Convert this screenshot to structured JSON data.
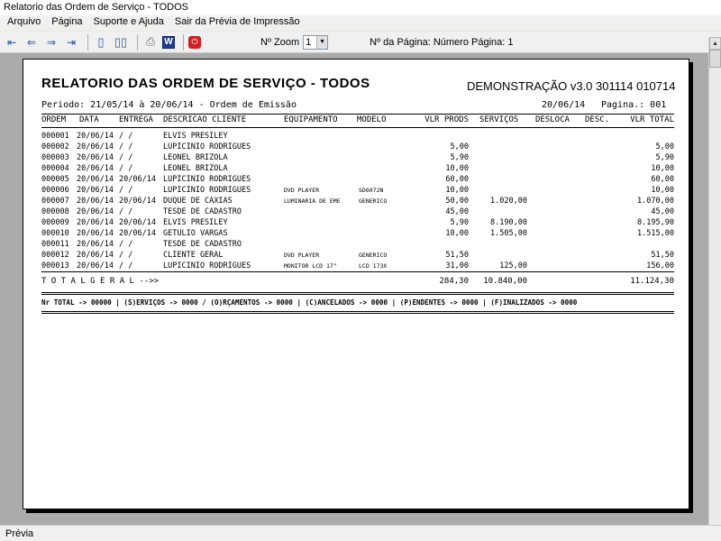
{
  "window": {
    "title": "Relatorio das Ordem de Serviço - TODOS"
  },
  "menu": [
    "Arquivo",
    "Página",
    "Suporte e Ajuda",
    "Sair da Prévia de Impressão"
  ],
  "toolbar": {
    "icons": [
      "first-page-icon",
      "prev-page-icon",
      "next-page-icon",
      "last-page-icon",
      "single-page-icon",
      "two-pages-icon",
      "printer-icon",
      "word-export-icon",
      "stop-icon"
    ],
    "zoom_label": "Nº Zoom",
    "zoom_value": "1",
    "page_info": "Nº da Página: Número Página: 1"
  },
  "report": {
    "title": "RELATORIO DAS ORDEM DE SERVIÇO - TODOS",
    "version": "DEMONSTRAÇÃO v3.0 301114 010714",
    "periodo": "Periodo: 21/05/14 à 20/06/14 - Ordem de Emissão",
    "date": "20/06/14",
    "pagina": "Pagina.: 001",
    "columns": {
      "ordem": "ORDEM",
      "data": "DATA",
      "entrega": "ENTREGA",
      "cliente": "DESCRICAO CLIENTE",
      "equipamento": "EQUIPAMENTO",
      "modelo": "MODELO",
      "vlr_prods": "VLR PRODS",
      "servicos": "SERVIÇOS",
      "desloca": "DESLOCA",
      "desc": "DESC.",
      "vlr_total": "VLR TOTAL"
    },
    "rows": [
      {
        "ordem": "000001",
        "data": "20/06/14",
        "entrega": " /  /",
        "cliente": "ELVIS PRESILEY",
        "equip": "",
        "modelo": "",
        "vlr": "",
        "serv": "",
        "total": ""
      },
      {
        "ordem": "000002",
        "data": "20/06/14",
        "entrega": " /  /",
        "cliente": "LUPICINIO RODRIGUES",
        "equip": "",
        "modelo": "",
        "vlr": "5,00",
        "serv": "",
        "total": "5,00"
      },
      {
        "ordem": "000003",
        "data": "20/06/14",
        "entrega": " /  /",
        "cliente": "LEONEL BRIZOLA",
        "equip": "",
        "modelo": "",
        "vlr": "5,90",
        "serv": "",
        "total": "5,90"
      },
      {
        "ordem": "000004",
        "data": "20/06/14",
        "entrega": " /  /",
        "cliente": "LEONEL BRIZOLA",
        "equip": "",
        "modelo": "",
        "vlr": "10,00",
        "serv": "",
        "total": "10,00"
      },
      {
        "ordem": "000005",
        "data": "20/06/14",
        "entrega": "20/06/14",
        "cliente": "LUPICINIO RODRIGUES",
        "equip": "",
        "modelo": "",
        "vlr": "60,00",
        "serv": "",
        "total": "60,00"
      },
      {
        "ordem": "000006",
        "data": "20/06/14",
        "entrega": " /  /",
        "cliente": "LUPICINIO RODRIGUES",
        "equip": "DVD PLAYER",
        "modelo": "SD6072N",
        "vlr": "10,00",
        "serv": "",
        "total": "10,00"
      },
      {
        "ordem": "000007",
        "data": "20/06/14",
        "entrega": "20/06/14",
        "cliente": "DUQUE DE CAXIAS",
        "equip": "LUMINARIA DE EME",
        "modelo": "GENERICO",
        "vlr": "50,00",
        "serv": "1.020,00",
        "total": "1.070,00"
      },
      {
        "ordem": "000008",
        "data": "20/06/14",
        "entrega": " /  /",
        "cliente": "TESDE DE CADASTRO",
        "equip": "",
        "modelo": "",
        "vlr": "45,00",
        "serv": "",
        "total": "45,00"
      },
      {
        "ordem": "000009",
        "data": "20/06/14",
        "entrega": "20/06/14",
        "cliente": "ELVIS PRESILEY",
        "equip": "",
        "modelo": "",
        "vlr": "5,90",
        "serv": "8.190,00",
        "total": "8.195,90"
      },
      {
        "ordem": "000010",
        "data": "20/06/14",
        "entrega": "20/06/14",
        "cliente": "GETULIO VARGAS",
        "equip": "",
        "modelo": "",
        "vlr": "10,00",
        "serv": "1.505,00",
        "total": "1.515,00"
      },
      {
        "ordem": "000011",
        "data": "20/06/14",
        "entrega": " /  /",
        "cliente": "TESDE DE CADASTRO",
        "equip": "",
        "modelo": "",
        "vlr": "",
        "serv": "",
        "total": ""
      },
      {
        "ordem": "000012",
        "data": "20/06/14",
        "entrega": " /  /",
        "cliente": "CLIENTE GERAL",
        "equip": "DVD PLAYER",
        "modelo": "GENERICO",
        "vlr": "51,50",
        "serv": "",
        "total": "51,50"
      },
      {
        "ordem": "000013",
        "data": "20/06/14",
        "entrega": " /  /",
        "cliente": "LUPICINIO RODRIGUES",
        "equip": "MONITOR LCD 17\"",
        "modelo": "LCD 173X",
        "vlr": "31,00",
        "serv": "125,00",
        "total": "156,00"
      }
    ],
    "totals": {
      "label": "T O T A L   G E R A L   -->>",
      "vlr": "284,30",
      "serv": "10.840,00",
      "total": "11.124,30"
    },
    "summary": "Nr TOTAL -> 00000 | (S)ERVIÇOS -> 0000 / (O)RÇAMENTOS -> 0000 | (C)ANCELADOS -> 0000 | (P)ENDENTES -> 0000 | (F)INALIZADOS -> 0000"
  },
  "status": "Prévia"
}
